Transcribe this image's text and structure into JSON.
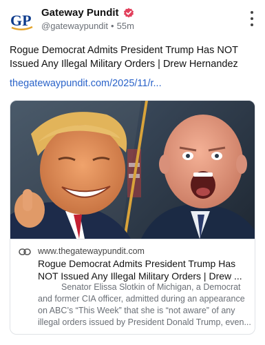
{
  "account": {
    "display_name": "Gateway Pundit",
    "handle": "@gatewaypundit",
    "separator": "•",
    "timestamp": "55m",
    "avatar_letters": "GP",
    "brand_color": "#0d3b8c",
    "accent_color": "#e4a32b",
    "verified_color": "#e2405c"
  },
  "post": {
    "text": "Rogue Democrat Admits President Trump Has NOT Issued Any Illegal Military Orders | Drew Hernandez",
    "link_text": "thegatewaypundit.com/2025/11/r..."
  },
  "card": {
    "domain": "www.thegatewaypundit.com",
    "title": "Rogue Democrat Admits President Trump Has NOT Issued Any Illegal Military Orders | Drew ...",
    "description": "Senator Elissa Slotkin of Michigan, a Democrat and former CIA officer, admitted during an appearance on ABC’s “This Week” that she is “not aware” of any illegal orders issued by President Donald Trump, even..."
  },
  "icons": {
    "more": "more-vertical-icon",
    "link": "link-icon",
    "verified": "verified-badge-icon"
  }
}
